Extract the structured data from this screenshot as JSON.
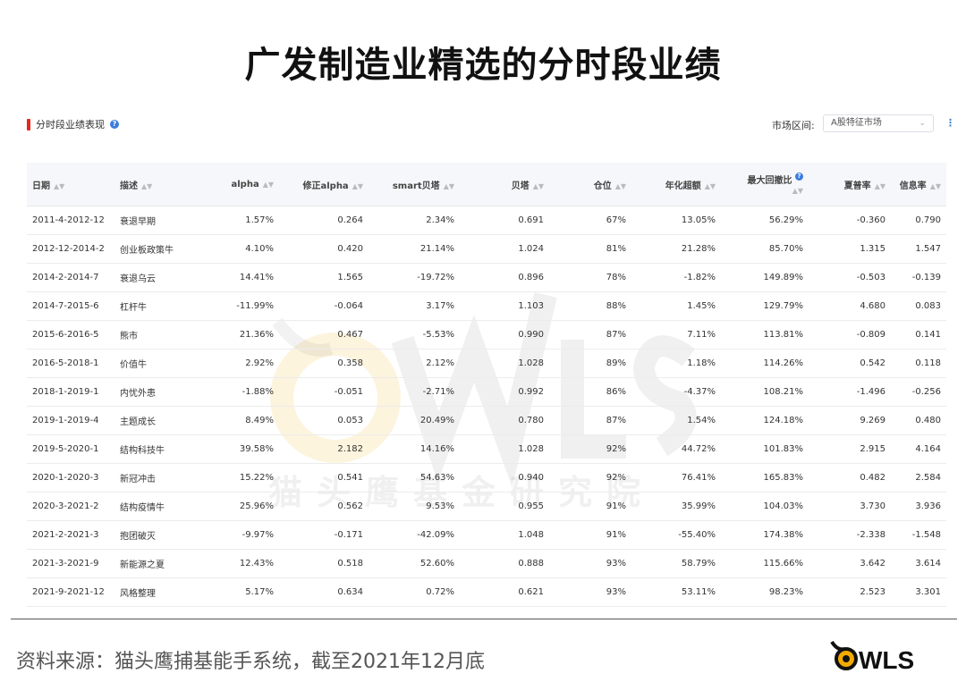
{
  "title": "广发制造业精选的分时段业绩",
  "section": {
    "label": "分时段业绩表现",
    "info_icon": "?"
  },
  "market": {
    "label": "市场区间:",
    "selected": "A股特征市场",
    "more": "⋮"
  },
  "table": {
    "headers": [
      "日期",
      "描述",
      "alpha",
      "修正alpha",
      "smart贝塔",
      "贝塔",
      "仓位",
      "年化超额",
      "最大回撤比",
      "夏普率",
      "信息率"
    ],
    "rows": [
      [
        "2011-4-2012-12",
        "衰退早期",
        "1.57%",
        "0.264",
        "2.34%",
        "0.691",
        "67%",
        "13.05%",
        "56.29%",
        "-0.360",
        "0.790"
      ],
      [
        "2012-12-2014-2",
        "创业板政策牛",
        "4.10%",
        "0.420",
        "21.14%",
        "1.024",
        "81%",
        "21.28%",
        "85.70%",
        "1.315",
        "1.547"
      ],
      [
        "2014-2-2014-7",
        "衰退乌云",
        "14.41%",
        "1.565",
        "-19.72%",
        "0.896",
        "78%",
        "-1.82%",
        "149.89%",
        "-0.503",
        "-0.139"
      ],
      [
        "2014-7-2015-6",
        "杠杆牛",
        "-11.99%",
        "-0.064",
        "3.17%",
        "1.103",
        "88%",
        "1.45%",
        "129.79%",
        "4.680",
        "0.083"
      ],
      [
        "2015-6-2016-5",
        "熊市",
        "21.36%",
        "0.467",
        "-5.53%",
        "0.990",
        "87%",
        "7.11%",
        "113.81%",
        "-0.809",
        "0.141"
      ],
      [
        "2016-5-2018-1",
        "价值牛",
        "2.92%",
        "0.358",
        "2.12%",
        "1.028",
        "89%",
        "1.18%",
        "114.26%",
        "0.542",
        "0.118"
      ],
      [
        "2018-1-2019-1",
        "内忧外患",
        "-1.88%",
        "-0.051",
        "-2.71%",
        "0.992",
        "86%",
        "-4.37%",
        "108.21%",
        "-1.496",
        "-0.256"
      ],
      [
        "2019-1-2019-4",
        "主题成长",
        "8.49%",
        "0.053",
        "20.49%",
        "0.780",
        "87%",
        "1.54%",
        "124.18%",
        "9.269",
        "0.480"
      ],
      [
        "2019-5-2020-1",
        "结构科技牛",
        "39.58%",
        "2.182",
        "14.16%",
        "1.028",
        "92%",
        "44.72%",
        "101.83%",
        "2.915",
        "4.164"
      ],
      [
        "2020-1-2020-3",
        "新冠冲击",
        "15.22%",
        "0.541",
        "54.63%",
        "0.940",
        "92%",
        "76.41%",
        "165.83%",
        "0.482",
        "2.584"
      ],
      [
        "2020-3-2021-2",
        "结构疫情牛",
        "25.96%",
        "0.562",
        "9.53%",
        "0.955",
        "91%",
        "35.99%",
        "104.03%",
        "3.730",
        "3.936"
      ],
      [
        "2021-2-2021-3",
        "抱团破灭",
        "-9.97%",
        "-0.171",
        "-42.09%",
        "1.048",
        "91%",
        "-55.40%",
        "174.38%",
        "-2.338",
        "-1.548"
      ],
      [
        "2021-3-2021-9",
        "新能源之夏",
        "12.43%",
        "0.518",
        "52.60%",
        "0.888",
        "93%",
        "58.79%",
        "115.66%",
        "3.642",
        "3.614"
      ],
      [
        "2021-9-2021-12",
        "风格整理",
        "5.17%",
        "0.634",
        "0.72%",
        "0.621",
        "93%",
        "53.11%",
        "98.23%",
        "2.523",
        "3.301"
      ]
    ]
  },
  "watermark_text": "猫头鹰基金研究院",
  "source": "资料来源：猫头鹰捕基能手系统，截至2021年12月底",
  "logo_text": "WLS",
  "colors": {
    "accent": "#e8281c",
    "info": "#3b7ddd",
    "header_bg": "#f5f7fa",
    "logo_eye": "#f2a900"
  }
}
